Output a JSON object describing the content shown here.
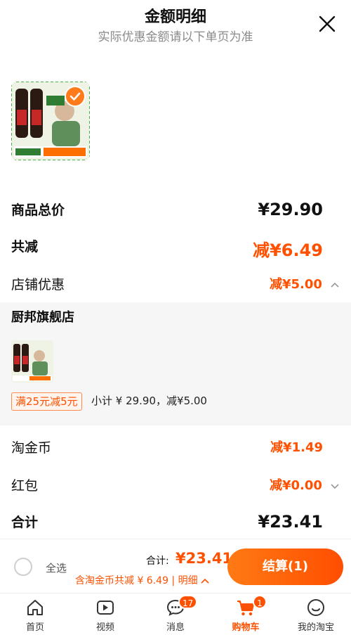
{
  "header": {
    "title": "金额明细",
    "subtitle": "实际优惠金额请以下单页为准"
  },
  "product": {
    "image_desc": "product-image"
  },
  "summary": {
    "goods_total_label": "商品总价",
    "goods_total_value": "¥29.90",
    "total_reduce_label": "共减",
    "total_reduce_value": "减¥6.49",
    "shop_discount_label": "店铺优惠",
    "shop_discount_value": "减¥5.00"
  },
  "shop": {
    "name": "厨邦旗舰店",
    "promo_tag": "满25元减5元",
    "subtotal": "小计 ¥ 29.90，减¥5.00"
  },
  "extras": {
    "coin_label": "淘金币",
    "coin_value": "减¥1.49",
    "redpacket_label": "红包",
    "redpacket_value": "减¥0.00",
    "total_label": "合计",
    "total_value": "¥23.41"
  },
  "bottom": {
    "select_all": "全选",
    "total_label": "合计:",
    "total_value": "¥23.41",
    "coin_line": "含淘金币共减 ¥ 6.49 | 明细",
    "checkout": "结算(1)"
  },
  "tabs": [
    {
      "label": "首页",
      "icon": "home-icon"
    },
    {
      "label": "视频",
      "icon": "video-icon"
    },
    {
      "label": "消息",
      "icon": "message-icon",
      "badge": "17"
    },
    {
      "label": "购物车",
      "icon": "cart-icon",
      "badge": "1"
    },
    {
      "label": "我的淘宝",
      "icon": "profile-icon"
    }
  ],
  "colors": {
    "accent": "#ff5000",
    "accent_light": "#ff7a14"
  }
}
